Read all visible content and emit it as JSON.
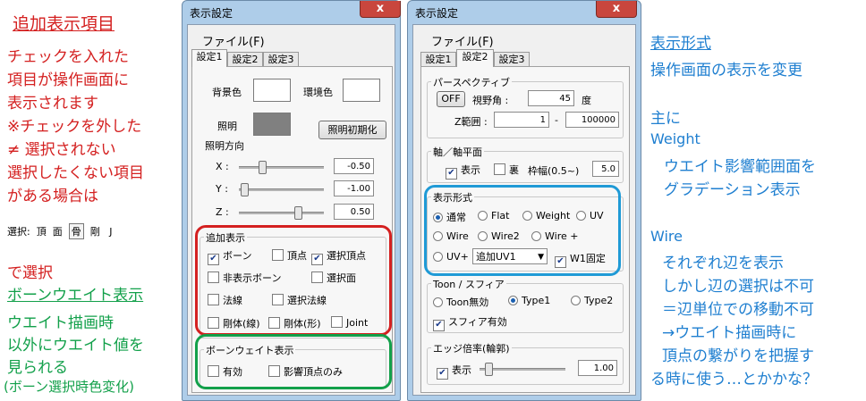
{
  "left_notes": {
    "heading": "追加表示項目",
    "lines": [
      "チェックを入れた",
      "項目が操作画面に",
      "表示されます",
      "※チェックを外した",
      "≠ 選択されない",
      "選択したくない項目",
      "がある場合は"
    ],
    "select_bar": {
      "prefix": "選択:",
      "items": [
        "頂",
        "面",
        "骨",
        "剛",
        "J"
      ]
    },
    "select_tail": "で選択",
    "bone_heading": "ボーンウエイト表示",
    "bone_lines": [
      "ウエイト描画時",
      "以外にウエイト値を",
      "見られる",
      "(ボーン選択時色変化)"
    ]
  },
  "right_notes": {
    "heading": "表示形式",
    "line1": "操作画面の表示を変更",
    "line2": "主に",
    "weight_title": "Weight",
    "weight_lines": [
      "ウエイト影響範囲面を",
      "グラデーション表示"
    ],
    "wire_title": "Wire",
    "wire_lines": [
      "それぞれ辺を表示",
      "しかし辺の選択は不可",
      "＝辺単位での移動不可",
      "→ウエイト描画時に",
      "頂点の繋がりを把握す",
      "る時に使う…とかかな？"
    ]
  },
  "window1": {
    "title": "表示設定",
    "close": "x",
    "menu": "ファイル(F)",
    "tabs": [
      "設定1",
      "設定2",
      "設定3"
    ],
    "bg_color_label": "背景色",
    "env_color_label": "環境色",
    "light_label": "照明",
    "light_reset": "照明初期化",
    "light_dir_label": "照明方向",
    "axes": [
      {
        "label": "X :",
        "value": "-0.50"
      },
      {
        "label": "Y :",
        "value": "-1.00"
      },
      {
        "label": "Z :",
        "value": "0.50"
      }
    ],
    "extra_group": "追加表示",
    "extra_items": [
      {
        "label": "ボーン",
        "checked": true
      },
      {
        "label": "頂点",
        "checked": false
      },
      {
        "label": "選択頂点",
        "checked": true
      },
      {
        "label": "非表示ボーン",
        "checked": false
      },
      {
        "label": "選択面",
        "checked": false
      },
      {
        "label": "法線",
        "checked": false
      },
      {
        "label": "選択法線",
        "checked": false
      },
      {
        "label": "剛体(線)",
        "checked": false
      },
      {
        "label": "剛体(形)",
        "checked": false
      },
      {
        "label": "Joint",
        "checked": false
      }
    ],
    "bone_group": "ボーンウェイト表示",
    "bone_items": [
      {
        "label": "有効",
        "checked": false
      },
      {
        "label": "影響頂点のみ",
        "checked": false
      }
    ]
  },
  "window2": {
    "title": "表示設定",
    "close": "x",
    "menu": "ファイル(F)",
    "tabs": [
      "設定1",
      "設定2",
      "設定3"
    ],
    "persp_group": "パースペクティブ",
    "persp_btn": "OFF",
    "fov_label": "視野角 :",
    "fov_value": "45",
    "fov_unit": "度",
    "zrange_label": "Z範囲 :",
    "z_min": "1",
    "z_sep": "-",
    "z_max": "100000",
    "axis_group": "軸／軸平面",
    "axis_show": {
      "label": "表示",
      "checked": true
    },
    "axis_back": {
      "label": "裏",
      "checked": false
    },
    "frame_label": "枠幅(0.5~)",
    "frame_value": "5.0",
    "format_group": "表示形式",
    "format_options": [
      {
        "label": "通常",
        "selected": true
      },
      {
        "label": "Flat",
        "selected": false
      },
      {
        "label": "Weight",
        "selected": false
      },
      {
        "label": "UV",
        "selected": false
      },
      {
        "label": "Wire",
        "selected": false
      },
      {
        "label": "Wire2",
        "selected": false
      },
      {
        "label": "Wire +",
        "selected": false
      },
      {
        "label": "UV+",
        "selected": false
      }
    ],
    "uv_select": "追加UV1",
    "w1_fixed": {
      "label": "W1固定",
      "checked": true
    },
    "toon_group": "Toon / スフィア",
    "toon_options": [
      {
        "label": "Toon無効",
        "selected": false
      },
      {
        "label": "Type1",
        "selected": true
      },
      {
        "label": "Type2",
        "selected": false
      }
    ],
    "sphere": {
      "label": "スフィア有効",
      "checked": true
    },
    "edge_group": "エッジ倍率(輪郭)",
    "edge_show": {
      "label": "表示",
      "checked": true
    },
    "edge_value": "1.00"
  },
  "colors": {
    "red": "#d42020",
    "green": "#12a04a",
    "blue": "#1f7fd0",
    "light_swatch": "#808080"
  }
}
